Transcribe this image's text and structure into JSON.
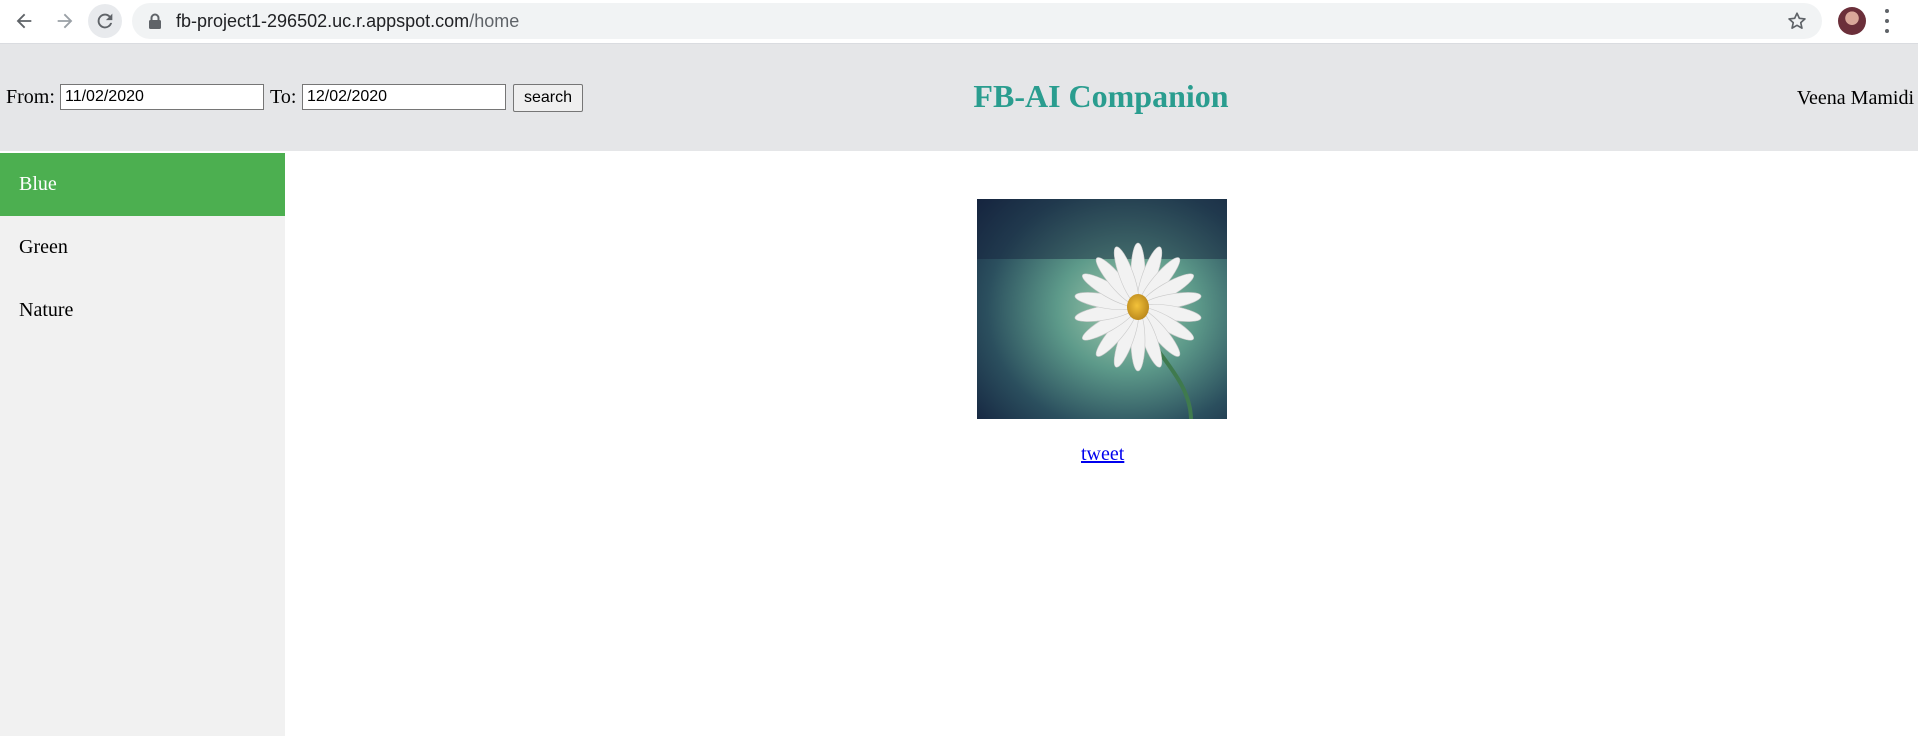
{
  "browser": {
    "url_host": "fb-project1-296502.uc.r.appspot.com",
    "url_path": "/home"
  },
  "header": {
    "from_label": "From:",
    "from_value": "11/02/2020",
    "to_label": "To:",
    "to_value": "12/02/2020",
    "search_label": "search",
    "title": "FB-AI Companion",
    "user_name": "Veena Mamidi",
    "title_color": "#2a9d8f"
  },
  "sidebar": {
    "items": [
      {
        "label": "Blue",
        "active": true
      },
      {
        "label": "Green",
        "active": false
      },
      {
        "label": "Nature",
        "active": false
      }
    ],
    "active_color": "#4caf50"
  },
  "main": {
    "image_icon": "daisy-flower-photo",
    "link_label": "tweet"
  }
}
